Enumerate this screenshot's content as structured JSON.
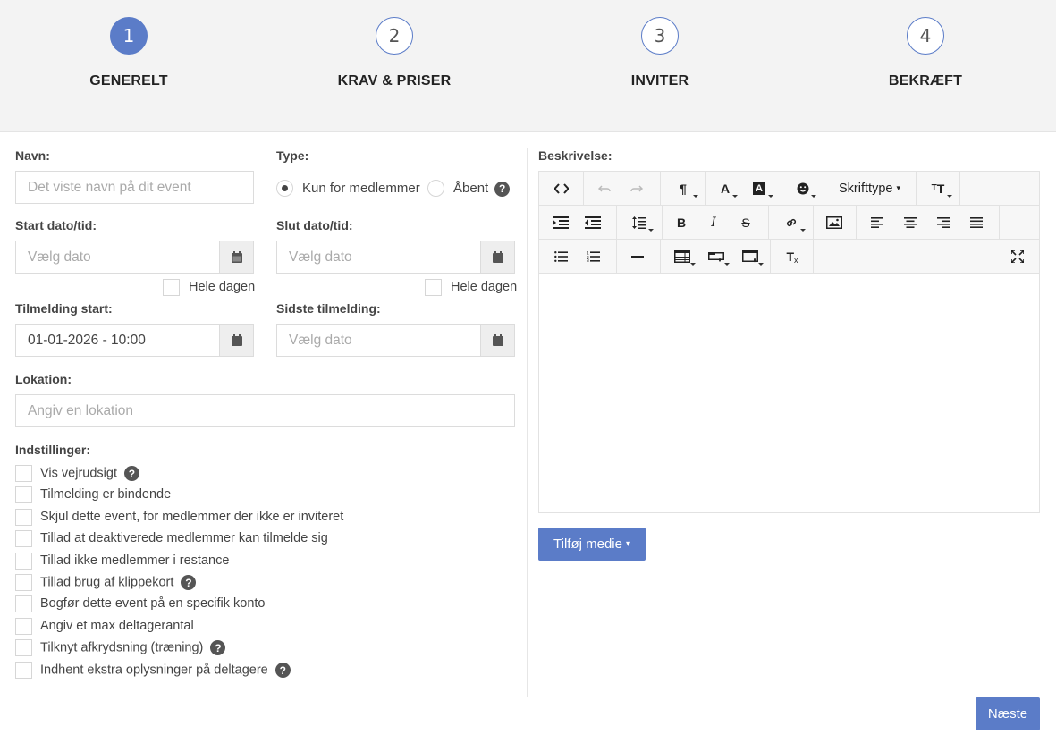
{
  "steps": [
    {
      "number": "1",
      "label": "GENERELT"
    },
    {
      "number": "2",
      "label": "KRAV & PRISER"
    },
    {
      "number": "3",
      "label": "INVITER"
    },
    {
      "number": "4",
      "label": "BEKRÆFT"
    }
  ],
  "form": {
    "name_label": "Navn:",
    "name_placeholder": "Det viste navn på dit event",
    "type_label": "Type:",
    "type_option_members": "Kun for medlemmer",
    "type_option_open": "Åbent",
    "start_label": "Start dato/tid:",
    "start_placeholder": "Vælg dato",
    "end_label": "Slut dato/tid:",
    "end_placeholder": "Vælg dato",
    "all_day_label": "Hele dagen",
    "signup_start_label": "Tilmelding start:",
    "signup_start_value": "01-01-2026 - 10:00",
    "last_signup_label": "Sidste tilmelding:",
    "last_signup_placeholder": "Vælg dato",
    "location_label": "Lokation:",
    "location_placeholder": "Angiv en lokation",
    "settings_label": "Indstillinger:",
    "settings": [
      {
        "label": "Vis vejrudsigt",
        "help": true
      },
      {
        "label": "Tilmelding er bindende",
        "help": false
      },
      {
        "label": "Skjul dette event, for medlemmer der ikke er inviteret",
        "help": false
      },
      {
        "label": "Tillad at deaktiverede medlemmer kan tilmelde sig",
        "help": false
      },
      {
        "label": "Tillad ikke medlemmer i restance",
        "help": false
      },
      {
        "label": "Tillad brug af klippekort",
        "help": true
      },
      {
        "label": "Bogfør dette event på en specifik konto",
        "help": false
      },
      {
        "label": "Angiv et max deltagerantal",
        "help": false
      },
      {
        "label": "Tilknyt afkrydsning (træning)",
        "help": true
      },
      {
        "label": "Indhent ekstra oplysninger på deltagere",
        "help": true
      }
    ]
  },
  "editor": {
    "label": "Beskrivelse:",
    "font_dropdown": "Skrifttype"
  },
  "buttons": {
    "add_media": "Tilføj medie",
    "next": "Næste",
    "help_glyph": "?"
  },
  "colors": {
    "accent": "#5b7cc8"
  }
}
